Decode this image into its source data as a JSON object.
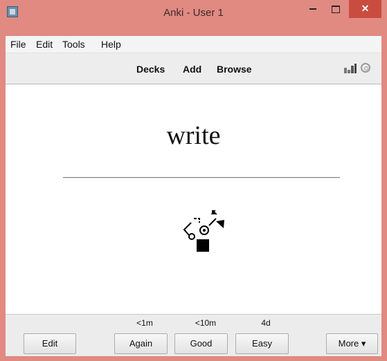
{
  "window": {
    "title": "Anki - User 1",
    "min_symbol": "",
    "max_symbol": "",
    "close_symbol": "✕"
  },
  "menu": {
    "items": [
      "File",
      "Edit",
      "Tools",
      "Help"
    ]
  },
  "toolbar": {
    "links": [
      "Decks",
      "Add",
      "Browse"
    ],
    "right_icons": [
      "stats-icon",
      "sync-icon"
    ]
  },
  "card": {
    "front_text": "write",
    "image": "abstract-symbols-image"
  },
  "answer_bar": {
    "edit_label": "Edit",
    "more_label": "More ▾",
    "buttons": [
      {
        "label": "Again",
        "interval": "<1m"
      },
      {
        "label": "Good",
        "interval": "<10m"
      },
      {
        "label": "Easy",
        "interval": "4d"
      }
    ]
  },
  "colors": {
    "titlebar": "#e08a82",
    "close_button": "#c84d40",
    "toolbar": "#ededed"
  }
}
